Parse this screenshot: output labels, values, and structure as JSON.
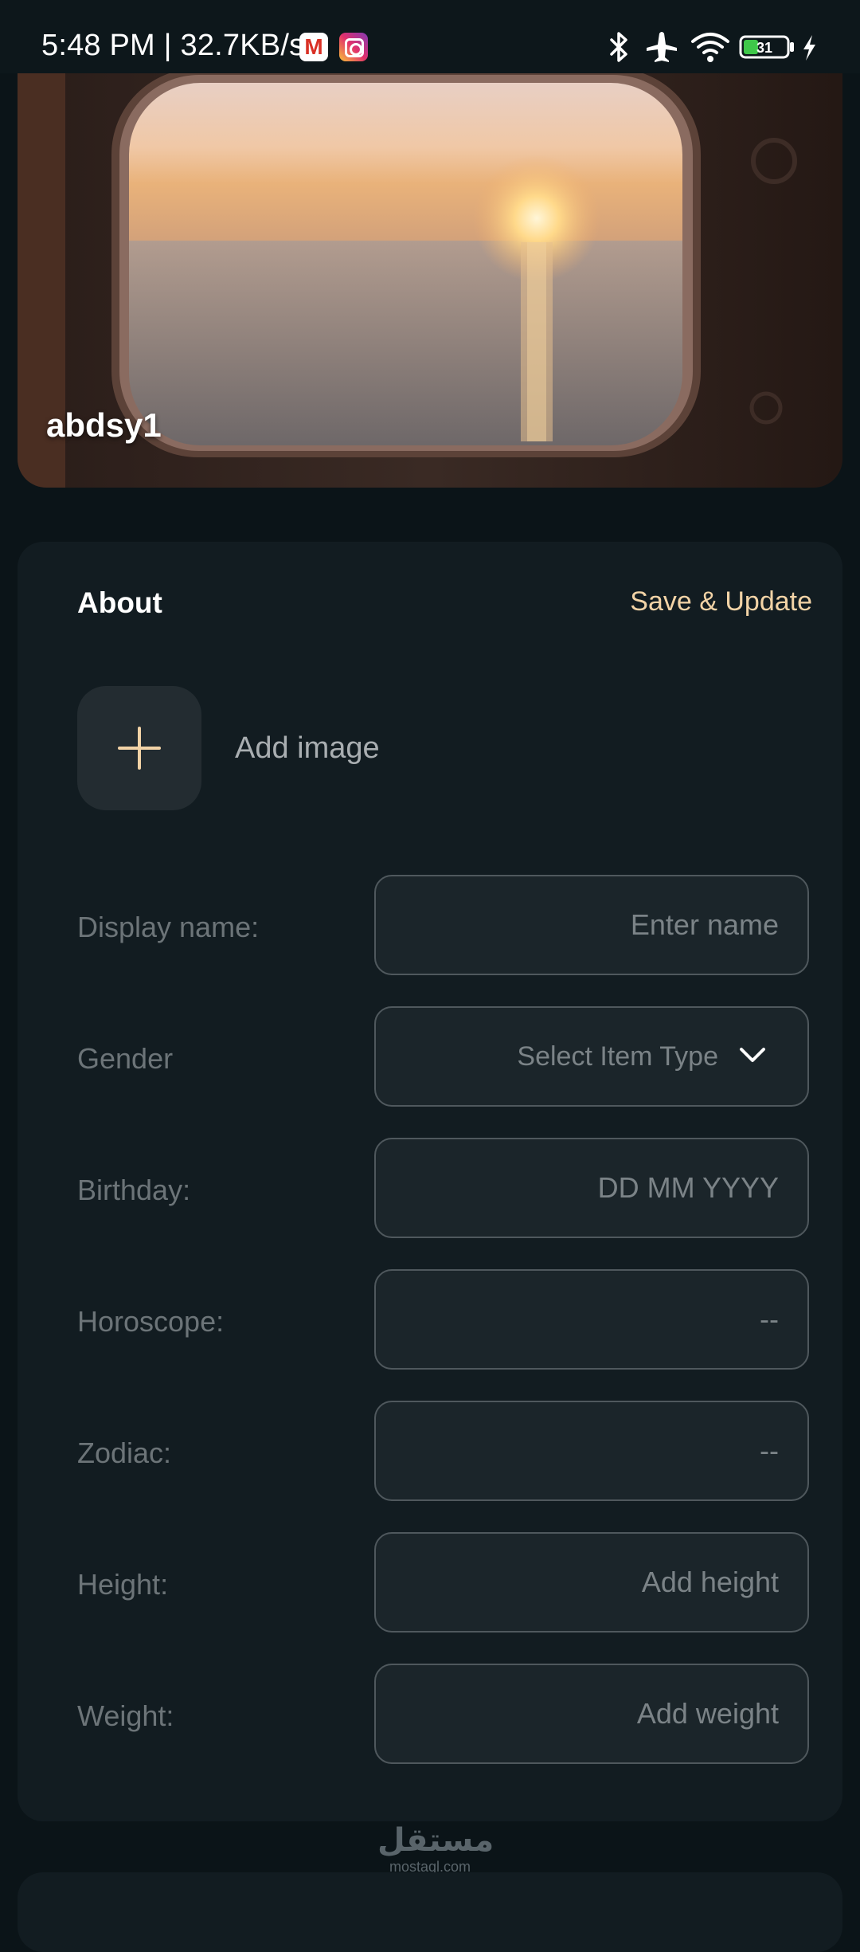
{
  "status_bar": {
    "time_and_speed": "5:48 PM | 32.7KB/s",
    "battery_level": "31"
  },
  "header": {
    "profile_name": "abdsy1"
  },
  "about": {
    "title": "About",
    "save_label": "Save & Update",
    "add_image_label": "Add image",
    "fields": {
      "display_name": {
        "label": "Display name:",
        "placeholder": "Enter name"
      },
      "gender": {
        "label": "Gender",
        "value": "Select Item Type"
      },
      "birthday": {
        "label": "Birthday:",
        "placeholder": "DD MM YYYY"
      },
      "horoscope": {
        "label": "Horoscope:",
        "placeholder": "--"
      },
      "zodiac": {
        "label": "Zodiac:",
        "placeholder": "--"
      },
      "height": {
        "label": "Height:",
        "placeholder": "Add height"
      },
      "weight": {
        "label": "Weight:",
        "placeholder": "Add weight"
      }
    }
  },
  "watermark": {
    "arabic": "مستقل",
    "latin": "mostaql.com"
  },
  "colors": {
    "background": "#0b1418",
    "card": "#121c21",
    "accent": "#f2d3a6",
    "field_bg": "#1b252a",
    "field_border": "#4f585d",
    "muted_text": "#6c7478"
  }
}
